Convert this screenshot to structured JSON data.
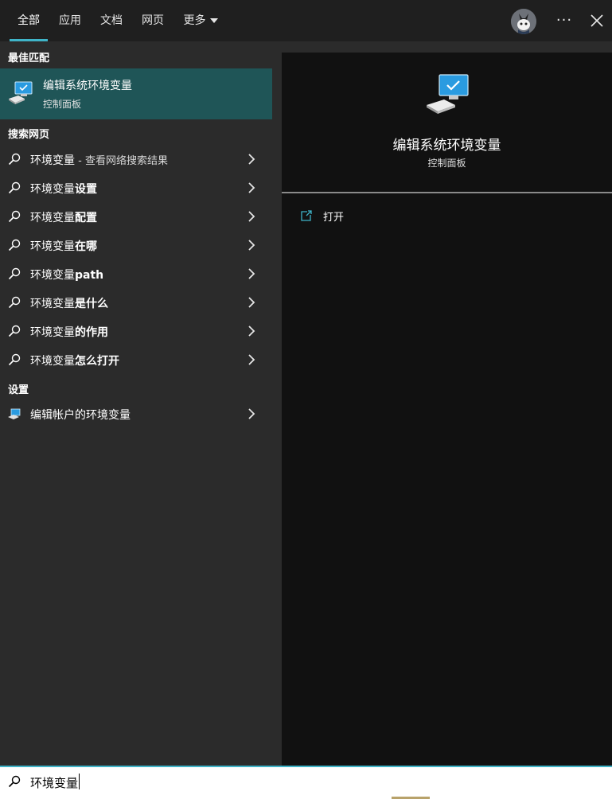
{
  "tabs": [
    {
      "label": "全部",
      "active": true
    },
    {
      "label": "应用",
      "active": false
    },
    {
      "label": "文档",
      "active": false
    },
    {
      "label": "网页",
      "active": false
    },
    {
      "label": "更多",
      "active": false
    }
  ],
  "header": {
    "more_options_label": "···"
  },
  "left": {
    "best_match_heading": "最佳匹配",
    "best_match": {
      "title": "编辑系统环境变量",
      "subtitle": "控制面板",
      "icon": "computer-monitor-icon"
    },
    "web_heading": "搜索网页",
    "web_results": [
      {
        "prefix": "环境变量",
        "suffix": " - 查看网络搜索结果"
      },
      {
        "prefix": "环境变量",
        "suffix": "设置"
      },
      {
        "prefix": "环境变量",
        "suffix": "配置"
      },
      {
        "prefix": "环境变量",
        "suffix": "在哪"
      },
      {
        "prefix": "环境变量",
        "suffix": "path"
      },
      {
        "prefix": "环境变量",
        "suffix": "是什么"
      },
      {
        "prefix": "环境变量",
        "suffix": "的作用"
      },
      {
        "prefix": "环境变量",
        "suffix": "怎么打开"
      }
    ],
    "settings_heading": "设置",
    "settings_results": [
      {
        "label": "编辑帐户的环境变量",
        "icon": "laptop-icon"
      }
    ]
  },
  "right": {
    "title": "编辑系统环境变量",
    "subtitle": "控制面板",
    "actions": [
      {
        "label": "打开",
        "icon": "open-external-icon"
      }
    ]
  },
  "search": {
    "query": "环境变量"
  },
  "colors": {
    "accent": "#3fb4c8",
    "best_match_bg": "#1f5557",
    "left_bg": "#2b2b2b",
    "right_bg": "#111111"
  }
}
